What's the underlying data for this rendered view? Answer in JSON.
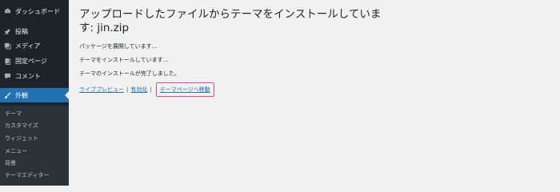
{
  "sidebar": {
    "items": [
      {
        "label": "ダッシュボード",
        "icon": "dashboard-icon"
      },
      {
        "label": "投稿",
        "icon": "pin-icon"
      },
      {
        "label": "メディア",
        "icon": "media-icon"
      },
      {
        "label": "固定ページ",
        "icon": "page-icon"
      },
      {
        "label": "コメント",
        "icon": "comment-icon"
      },
      {
        "label": "外観",
        "icon": "brush-icon",
        "active": true
      }
    ],
    "submenu": [
      "テーマ",
      "カスタマイズ",
      "ウィジェット",
      "メニュー",
      "背景",
      "テーマエディター"
    ]
  },
  "main": {
    "title": "アップロードしたファイルからテーマをインストールしています: jin.zip",
    "messages": [
      "パッケージを展開しています…",
      "テーマをインストールしています…",
      "テーマのインストールが完了しました。"
    ],
    "links": {
      "live_preview": "ライブプレビュー",
      "separator": "|",
      "activate": "有効化",
      "go_to_themes": "テーマページへ移動"
    }
  },
  "colors": {
    "sidebar_bg": "#1d2327",
    "active_bg": "#2271b1",
    "link": "#2271b1",
    "highlight_border": "#e04a8b"
  }
}
